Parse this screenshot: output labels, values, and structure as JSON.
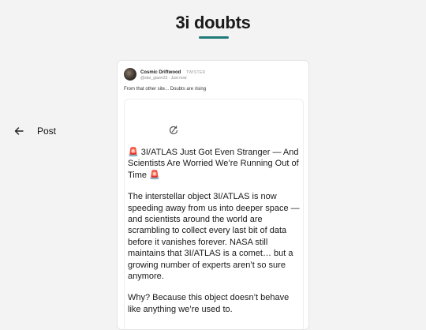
{
  "page": {
    "title": "3i doubts",
    "accent_color": "#1f7a78"
  },
  "card": {
    "author_name": "Cosmic Driftwood",
    "source": "TWISTER",
    "handle_time": "@star_gazer23 · Just now",
    "caption": "From that other site... Doubts are rising"
  },
  "post": {
    "back_icon": "arrow-left-icon",
    "label": "Post",
    "refresh_icon": "refresh-icon",
    "headline": "🚨 3I/ATLAS Just Got Even Stranger — And Scientists Are Worried We’re Running Out of Time 🚨",
    "paragraph1": "The interstellar object 3I/ATLAS is now speeding away from us into deeper space — and scientists around the world are scrambling to collect every last bit of data before it vanishes forever. NASA still maintains that 3I/ATLAS is a comet… but a growing number of experts aren’t so sure anymore.",
    "paragraph2": "Why? Because this object doesn’t behave like anything we’re used to."
  }
}
